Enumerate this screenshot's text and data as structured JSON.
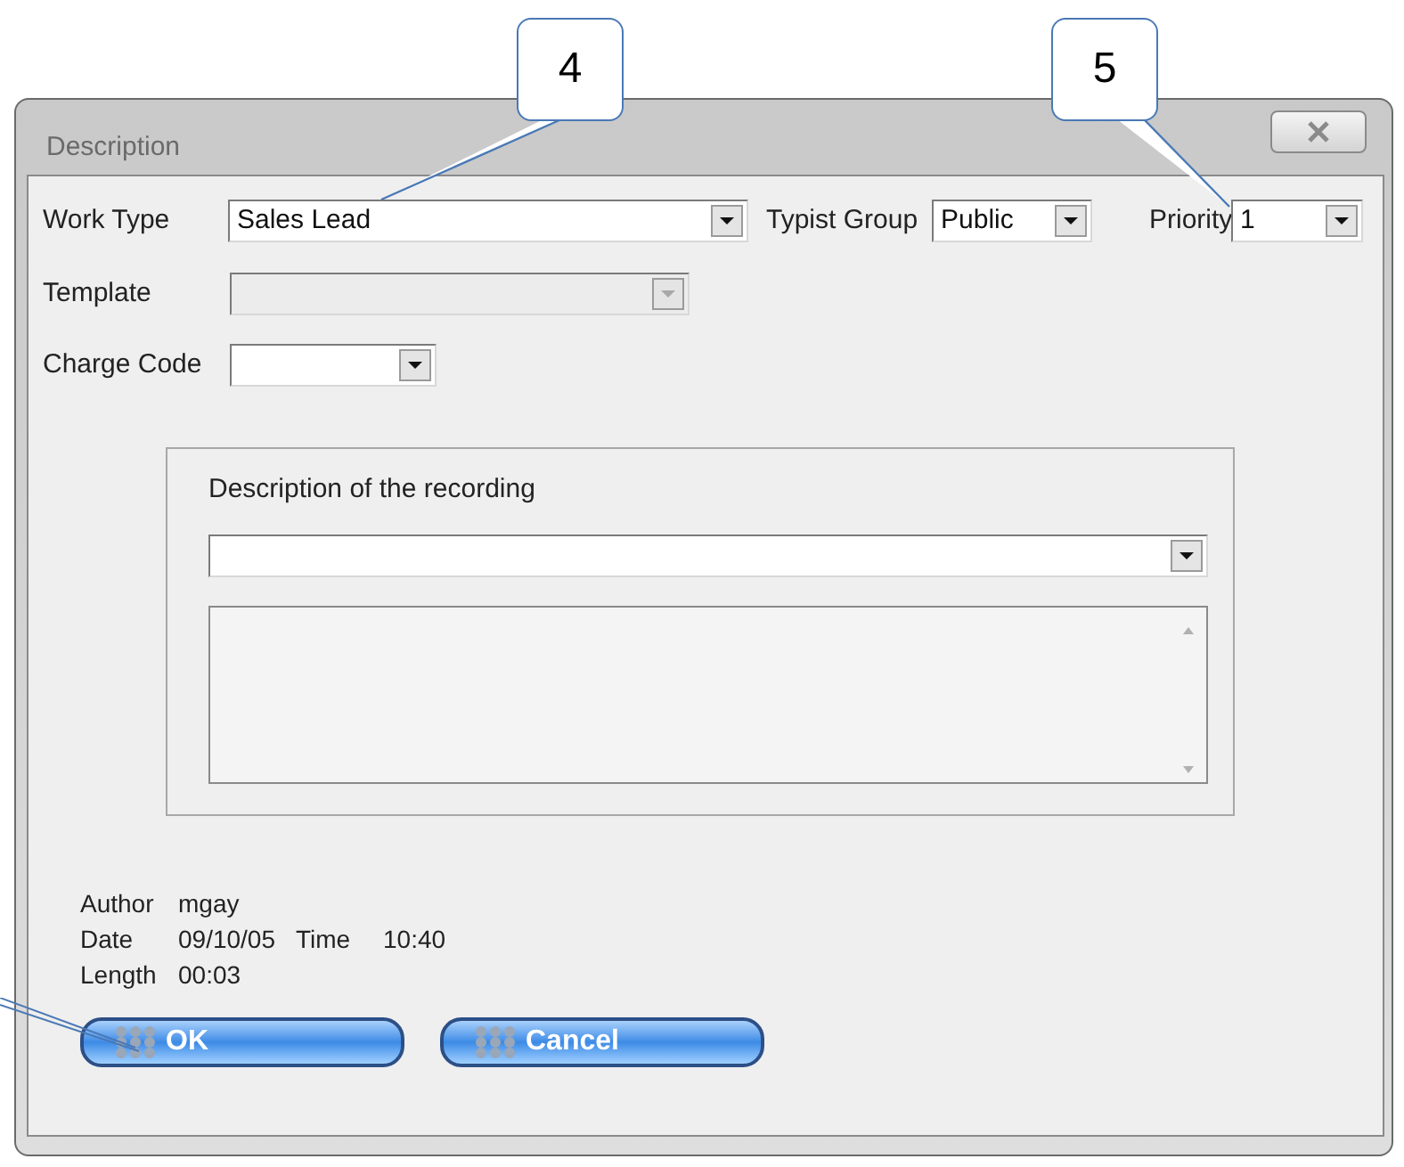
{
  "callouts": [
    {
      "label": "4"
    },
    {
      "label": "5"
    }
  ],
  "dialog": {
    "title": "Description",
    "row_1": [
      {
        "label": "Work Type",
        "value": "Sales Lead",
        "disabled": false
      },
      {
        "label": "Typist Group",
        "value": "Public",
        "disabled": false
      },
      {
        "label": "Priority",
        "value": "1",
        "disabled": false
      }
    ],
    "template": {
      "label": "Template",
      "disabled": true
    },
    "charge_code": {
      "label": "Charge Code",
      "disabled": false
    },
    "description_group": {
      "title": "Description of the recording"
    },
    "info": [
      {
        "label": "Author",
        "value": "mgay"
      },
      {
        "label": "Date",
        "value": "09/10/05",
        "label_2": "Time",
        "value_2": "10:40"
      },
      {
        "label": "Length",
        "value": "00:03"
      }
    ],
    "buttons": [
      "OK",
      "Cancel"
    ]
  }
}
